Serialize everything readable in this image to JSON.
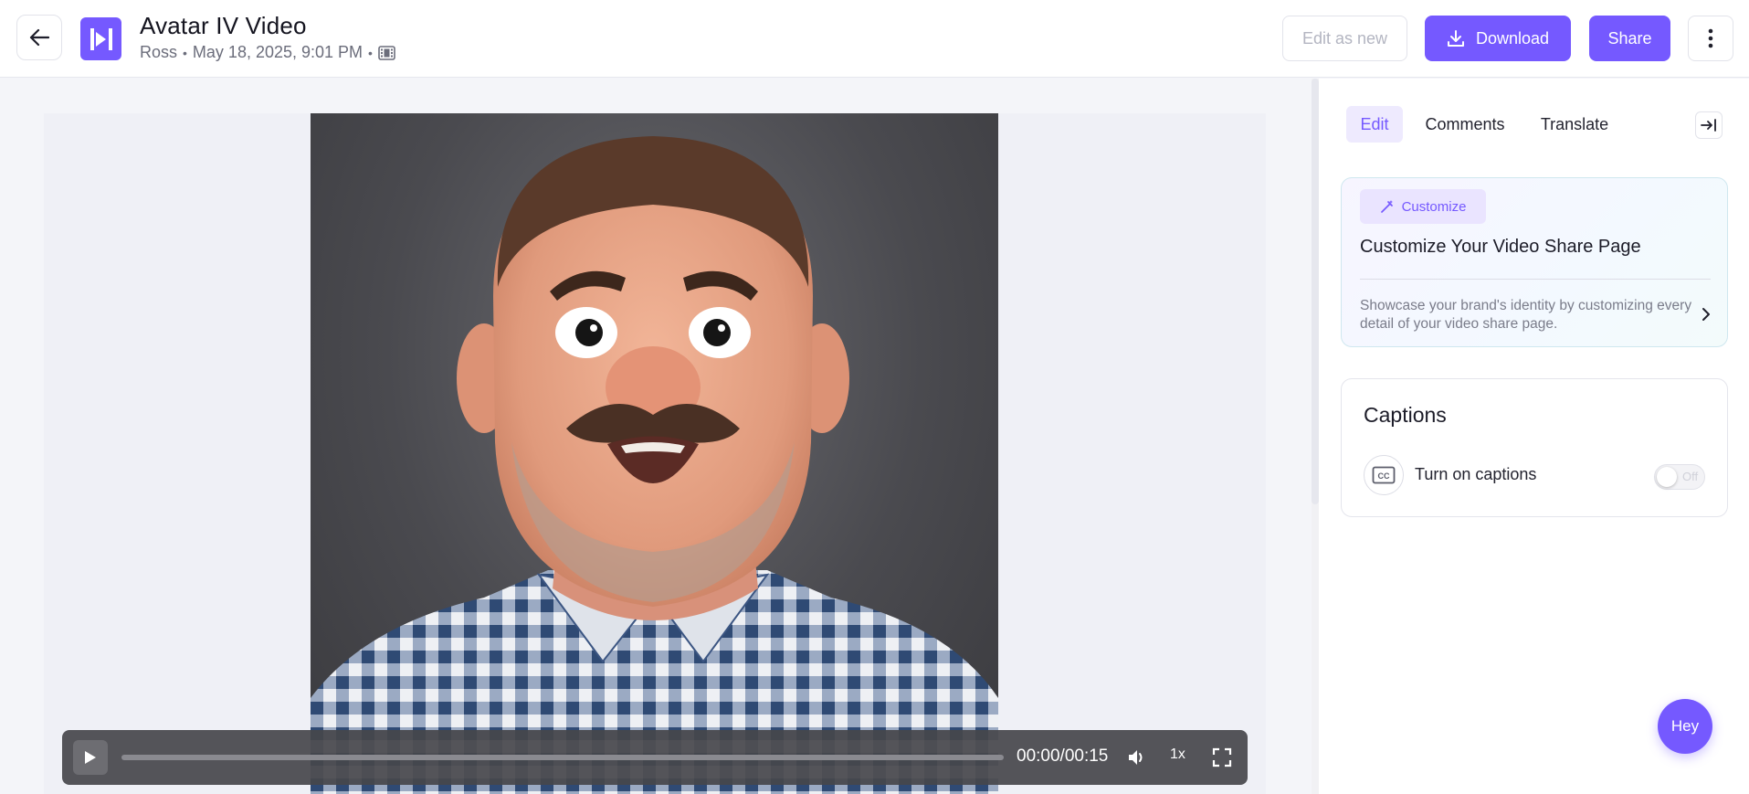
{
  "header": {
    "title": "Avatar IV Video",
    "author": "Ross",
    "date": "May 18, 2025, 9:01 PM",
    "edit_as_new_label": "Edit as new",
    "download_label": "Download",
    "share_label": "Share"
  },
  "player": {
    "time": "00:00/00:15",
    "speed": "1x",
    "progress": 0
  },
  "panel": {
    "tabs": [
      {
        "label": "Edit",
        "active": true
      },
      {
        "label": "Comments",
        "active": false
      },
      {
        "label": "Translate",
        "active": false
      }
    ],
    "customize": {
      "badge": "Customize",
      "title": "Customize Your Video Share Page",
      "description": "Showcase your brand's identity by customizing every detail of your video share page."
    },
    "captions": {
      "title": "Captions",
      "toggle_label": "Turn on captions",
      "toggle_state": "Off"
    }
  },
  "assistant": {
    "label": "Hey"
  },
  "colors": {
    "accent": "#7559ff",
    "accent_light": "#eeeafe"
  },
  "icons": [
    "arrow-left-icon",
    "logo-icon",
    "film-icon",
    "download-icon",
    "more-vertical-icon",
    "play-icon",
    "volume-icon",
    "fullscreen-icon",
    "collapse-panel-icon",
    "magic-wand-icon",
    "chevron-right-icon",
    "cc-icon"
  ]
}
